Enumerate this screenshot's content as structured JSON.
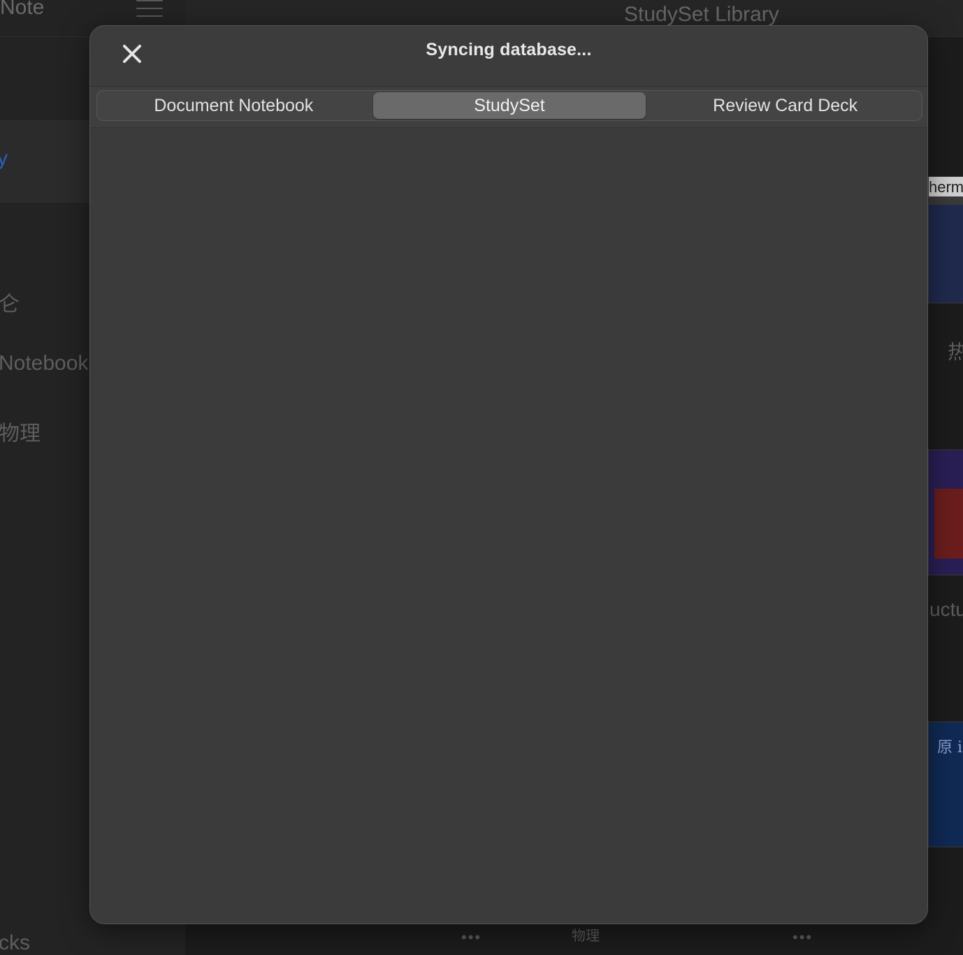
{
  "background": {
    "sidebar": {
      "app_title": "Note",
      "selected_item": "y",
      "items": [
        "仑",
        "Notebook",
        "物理",
        "cks"
      ]
    },
    "header": {
      "title": "StudySet Library"
    },
    "covers": {
      "cover1_text": "herma",
      "cover3_text": "原 i"
    },
    "fragments": {
      "hot": "热",
      "structure": "uctu"
    },
    "bottom_bar": {
      "left_dots": "•••",
      "label": "物理",
      "right_dots": "•••"
    }
  },
  "modal": {
    "title": "Syncing database...",
    "tabs": [
      {
        "label": "Document Notebook",
        "active": false
      },
      {
        "label": "StudySet",
        "active": true
      },
      {
        "label": "Review Card Deck",
        "active": false
      }
    ]
  },
  "icons": {
    "close": "close-icon",
    "menu": "hamburger-menu-icon"
  },
  "colors": {
    "modal_bg": "#3c3c3c",
    "active_tab": "#6a6a6a",
    "accent_blue": "#2c5fb8"
  }
}
